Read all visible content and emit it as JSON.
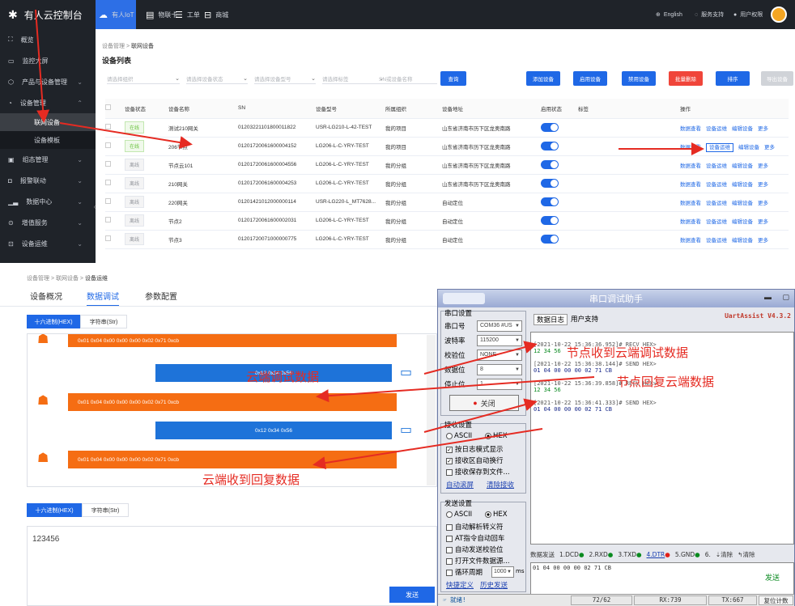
{
  "topbar": {
    "brand": "有人云控制台",
    "nav": [
      "有人IoT",
      "物联卡",
      "工单",
      "商城"
    ],
    "right": [
      "English",
      "服务支持",
      "用户权限"
    ]
  },
  "sidebar": {
    "items": [
      "概览",
      "监控大屏",
      "产品与设备管理",
      "设备管理",
      "联网设备",
      "设备模板",
      "组态管理",
      "报警联动",
      "数据中心",
      "增值服务",
      "设备运维"
    ]
  },
  "content": {
    "breadcrumb": [
      "设备管理",
      "联网设备"
    ],
    "page_title": "设备列表",
    "filters": [
      "请选择组织",
      "请选择设备状态",
      "请选择设备型号",
      "请选择标签",
      "SN或设备名称"
    ],
    "buttons": {
      "query": "查询",
      "add": "添加设备",
      "enable": "启用设备",
      "disable": "禁用设备",
      "delete": "批量删除",
      "sort": "排序",
      "more": "导出设备"
    },
    "columns": [
      "设备状态",
      "设备名称",
      "SN",
      "设备型号",
      "所属组织",
      "设备地址",
      "启用状态",
      "标签",
      "操作"
    ],
    "rows": [
      {
        "status": "在线",
        "name": "测试210网关",
        "sn": "01203221101800011822",
        "model": "USR-LG210-L-42-TEST",
        "org": "我的项目",
        "addr": "山东省济南市历下区龙奥南路"
      },
      {
        "status": "在线",
        "name": "206节点",
        "sn": "01201720061600004152",
        "model": "LG206-L-C-YRY-TEST",
        "org": "我的项目",
        "addr": "山东省济南市历下区龙奥南路"
      },
      {
        "status": "离线",
        "name": "节点云101",
        "sn": "01201720061600004556",
        "model": "LG206-L-C-YRY-TEST",
        "org": "我的分组",
        "addr": "山东省济南市历下区龙奥南路"
      },
      {
        "status": "离线",
        "name": "210网关",
        "sn": "01201720061600004253",
        "model": "LG206-L-C-YRY-TEST",
        "org": "我的分组",
        "addr": "山东省济南市历下区龙奥南路"
      },
      {
        "status": "离线",
        "name": "220网关",
        "sn": "01201421012000000114",
        "model": "USR-LG220-L_MT7628...",
        "org": "我的分组",
        "addr": "自动定位"
      },
      {
        "status": "离线",
        "name": "节点2",
        "sn": "01201720061600002031",
        "model": "LG206-L-C-YRY-TEST",
        "org": "我的分组",
        "addr": "自动定位"
      },
      {
        "status": "离线",
        "name": "节点3",
        "sn": "01201720071000000775",
        "model": "LG206-L-C-YRY-TEST",
        "org": "我的分组",
        "addr": "自动定位"
      }
    ],
    "ops": [
      "数据查看",
      "设备运维",
      "编辑设备",
      "更多"
    ]
  },
  "lower": {
    "breadcrumb": [
      "设备管理",
      "联网设备",
      "设备运维"
    ],
    "tabs": [
      "设备概况",
      "数据调试",
      "参数配置"
    ],
    "mode": [
      "十六进制(HEX)",
      "字符串(Str)"
    ],
    "msg_recv": "0x01 0x04 0x00 0x00 0x00 0x02 0x71 0xcb",
    "msg_send": "0x12 0x34 0x56",
    "input_value": "123456",
    "send": "发送"
  },
  "uart": {
    "title": "串口调试助手",
    "version": "UartAssist V4.3.2",
    "port_group": "串口设置",
    "port_lbl": "串口号",
    "port_val": "COM36 #US",
    "baud_lbl": "波特率",
    "baud_val": "115200",
    "parity_lbl": "校验位",
    "parity_val": "NONE",
    "data_lbl": "数据位",
    "data_val": "8",
    "stop_lbl": "停止位",
    "stop_val": "1",
    "close": "关闭",
    "recv_group": "接收设置",
    "ascii": "ASCII",
    "hex": "HEX",
    "recv_opts": [
      "按日志模式显示",
      "接收区自动换行",
      "接收保存到文件..."
    ],
    "recv_links": [
      "自动滚屏",
      "清除接收"
    ],
    "send_group": "发送设置",
    "send_opts": [
      "自动解析转义符",
      "AT指令自动回车",
      "自动发送校验位",
      "打开文件数据源...",
      "循环周期"
    ],
    "cycle_val": "1000",
    "cycle_unit": "ms",
    "send_links": [
      "快捷定义",
      "历史发送"
    ],
    "log_tabs": [
      "数据日志",
      "用户支持"
    ],
    "log": [
      {
        "h": "[2021-10-22 15:36:36.952]# RECV HEX>",
        "d": "12 34 56",
        "t": "recv"
      },
      {
        "h": "[2021-10-22 15:36:38.144]# SEND HEX>",
        "d": "01 04 00 00 00 02 71 CB",
        "t": "send"
      },
      {
        "h": "[2021-10-22 15:36:39.858]# RECV HEX>",
        "d": "12 34 56",
        "t": "recv"
      },
      {
        "h": "[2021-10-22 15:36:41.333]# SEND HEX>",
        "d": "01 04 00 00 00 02 71 CB",
        "t": "send"
      }
    ],
    "send_bar": {
      "label": "数据发送",
      "pins": [
        "1.DCD",
        "2.RXD",
        "3.TXD",
        "4.DTR",
        "5.GND",
        "6."
      ],
      "clear": "清除",
      "clear2": "清除"
    },
    "send_value": "01 04 00 00 00 02 71 CB",
    "send_btn": "发送",
    "status": {
      "ready": "就绪!",
      "count": "72/62",
      "rx": "RX:739",
      "tx": "TX:667",
      "reset": "复位计数"
    }
  },
  "annotations": {
    "node_recv": "节点收到云端调试数据",
    "node_reply": "节点回复云端数据",
    "cloud_debug": "云端调试数据",
    "cloud_recv": "云端收到回复数据"
  }
}
